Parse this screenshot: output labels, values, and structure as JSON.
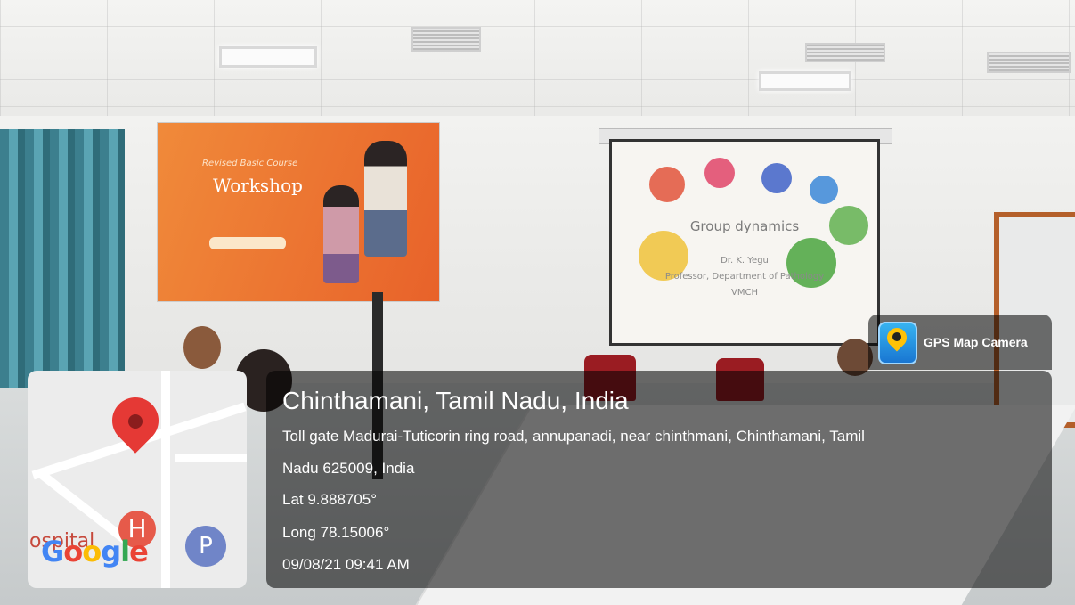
{
  "photo": {
    "banner": {
      "script_line": "Revised Basic Course",
      "title": "Workshop"
    },
    "projector_slide": {
      "title": "Group dynamics",
      "presenter": "Dr. K. Yegu",
      "role": "Professor, Department of Pathology",
      "institution": "VMCH"
    }
  },
  "app": {
    "name": "GPS Map Camera",
    "icon": "gps-map-camera-icon"
  },
  "location": {
    "title": "Chinthamani, Tamil Nadu, India",
    "address_line1": "Toll gate Madurai-Tuticorin ring road, annupanadi, near chinthmani, Chinthamani, Tamil",
    "address_line2": "Nadu 625009, India",
    "lat": "Lat 9.888705°",
    "long": "Long 78.15006°",
    "datetime": "09/08/21 09:41 AM"
  },
  "map": {
    "poi_label": "ospital",
    "hospital_marker": "H",
    "parking_marker": "P",
    "brand": "Google",
    "brand_colors": [
      "#4285F4",
      "#EA4335",
      "#FBBC05",
      "#4285F4",
      "#34A853",
      "#EA4335"
    ],
    "pin_color": "#e53935"
  }
}
